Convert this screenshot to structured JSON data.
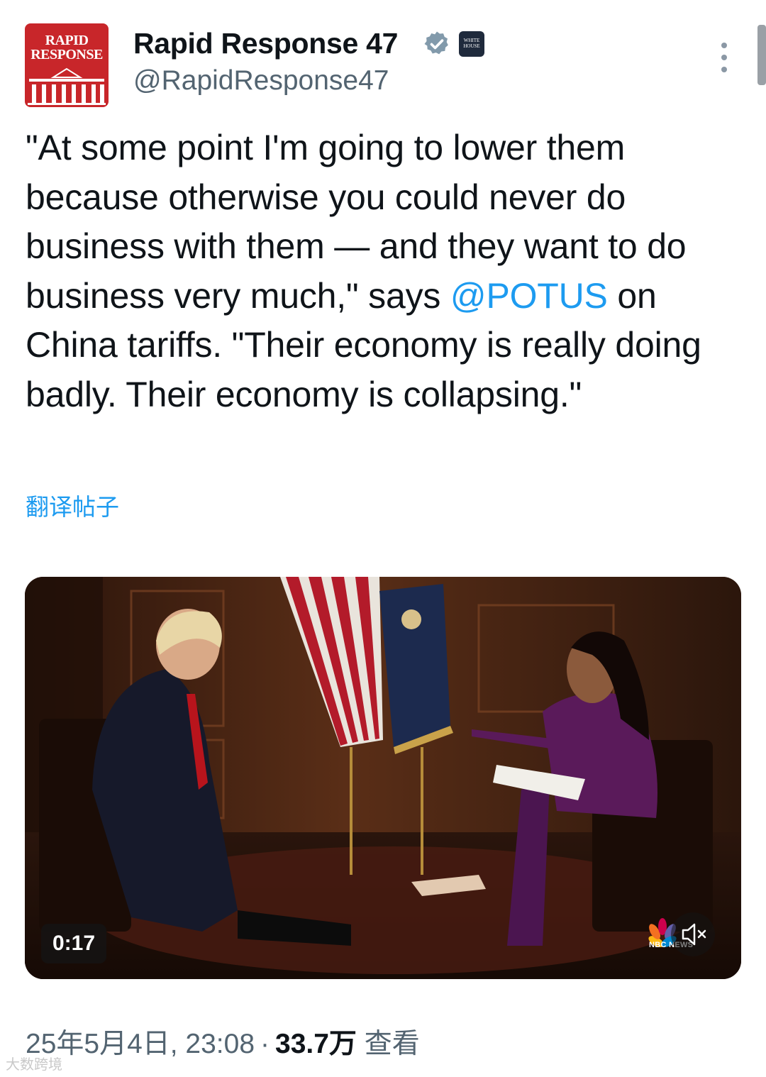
{
  "header": {
    "avatar_line1": "RAPID",
    "avatar_line2": "RESPONSE",
    "display_name": "Rapid Response 47",
    "handle": "@RapidResponse47",
    "verified_icon": "verified-badge-icon",
    "affiliate_badge": "WHITE HOUSE",
    "more_icon": "more-vertical-icon"
  },
  "tweet": {
    "text_before_mention": "\"At some point I'm going to lower them because otherwise you could never do business with them — and they want to do business very much,\" says ",
    "mention": "@POTUS",
    "text_after_mention": " on China tariffs. \"Their economy is really doing badly. Their economy is collapsing.\"",
    "translate_label": "翻译帖子"
  },
  "media": {
    "duration": "0:17",
    "network_logo": "NBC NEWS",
    "mute_icon": "volume-muted-icon"
  },
  "meta": {
    "timestamp": "25年5月4日, 23:08",
    "separator": "·",
    "views_count": "33.7万",
    "views_label": "查看"
  },
  "watermark": "大数跨境",
  "colors": {
    "accent": "#1d9bf0",
    "secondary_text": "#536471",
    "avatar_red": "#c8262a"
  }
}
